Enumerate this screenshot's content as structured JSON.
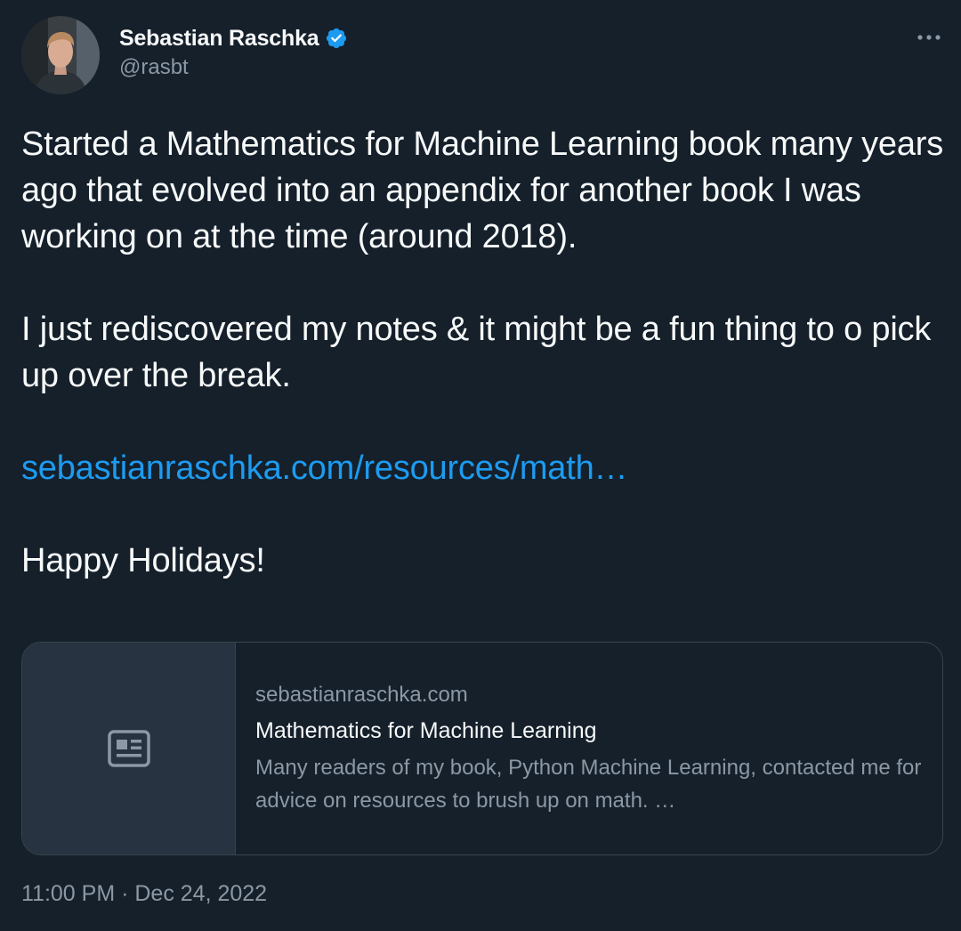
{
  "author": {
    "display_name": "Sebastian Raschka",
    "handle": "@rasbt",
    "verified": true,
    "avatar_icon": "profile-photo-avatar"
  },
  "menu": {
    "icon": "more-horizontal-icon"
  },
  "tweet": {
    "paragraph_1": "Started a Mathematics for Machine Learning book many years ago that evolved into an appendix for another book I was working on at the time (around 2018).",
    "paragraph_2": "I just rediscovered my notes & it might be a fun thing to o pick up over the break.",
    "link_text": "sebastianraschka.com/resources/math…",
    "paragraph_4": "Happy Holidays!"
  },
  "card": {
    "thumbnail_icon": "article-icon",
    "domain": "sebastianraschka.com",
    "title": "Mathematics for Machine Learning",
    "description": "Many readers of my book, Python Machine Learning, contacted me for advice on resources to brush up on math. …"
  },
  "timestamp": "11:00 PM · Dec 24, 2022",
  "colors": {
    "background": "#15202b",
    "text_primary": "#f7f9f9",
    "text_secondary": "#8b98a5",
    "link": "#1d9bf0",
    "verified_badge": "#1d9bf0",
    "border": "#38444d",
    "card_thumb_bg": "#273340"
  }
}
